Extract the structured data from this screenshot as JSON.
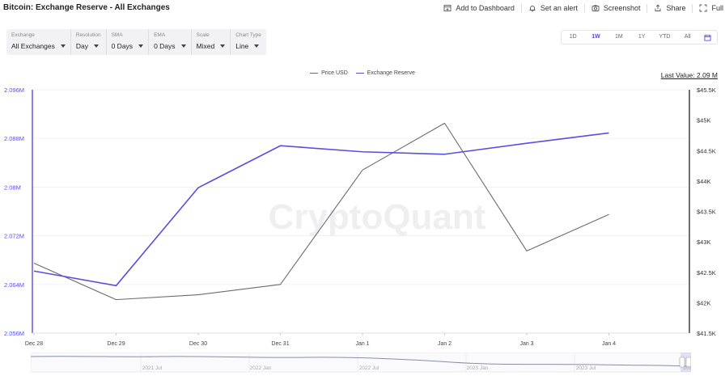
{
  "header": {
    "title": "Bitcoin: Exchange Reserve - All Exchanges",
    "actions": [
      {
        "label": "Add to Dashboard",
        "icon": "dashboard-icon"
      },
      {
        "label": "Set an alert",
        "icon": "bell-icon"
      },
      {
        "label": "Screenshot",
        "icon": "camera-icon"
      },
      {
        "label": "Share",
        "icon": "share-icon"
      },
      {
        "label": "Full",
        "icon": "fullscreen-icon"
      }
    ]
  },
  "filters": [
    {
      "label": "Exchange",
      "value": "All Exchanges"
    },
    {
      "label": "Resolution",
      "value": "Day"
    },
    {
      "label": "SMA",
      "value": "0 Days"
    },
    {
      "label": "EMA",
      "value": "0 Days"
    },
    {
      "label": "Scale",
      "value": "Mixed"
    },
    {
      "label": "Chart Type",
      "value": "Line"
    }
  ],
  "ranges": {
    "items": [
      "1D",
      "1W",
      "1M",
      "1Y",
      "YTD",
      "All"
    ],
    "active": "1W"
  },
  "last_value": "Last Value: 2.09 M",
  "colors": {
    "price": "#6b6b6b",
    "reserve": "#5a4fe0",
    "axis_left": "#5a4fe0",
    "axis_right": "#333333",
    "grid": "#ececf0",
    "navigator": "#8a8fa8"
  },
  "chart_data": {
    "type": "line",
    "watermark": "CryptoQuant",
    "categories": [
      "Dec 28",
      "Dec 29",
      "Dec 30",
      "Dec 31",
      "Jan 1",
      "Jan 2",
      "Jan 3",
      "Jan 4"
    ],
    "series": [
      {
        "name": "Price USD",
        "axis": "right",
        "values": [
          42650,
          42050,
          42130,
          42300,
          44180,
          44950,
          42850,
          43450
        ]
      },
      {
        "name": "Exchange Reserve",
        "axis": "left",
        "values": [
          2.0662,
          2.0638,
          2.0799,
          2.0868,
          2.0858,
          2.0854,
          2.0872,
          2.0889
        ]
      }
    ],
    "y_left": {
      "ticks": [
        "2.096M",
        "2.088M",
        "2.08M",
        "2.072M",
        "2.064M",
        "2.056M"
      ],
      "ylim": [
        2.056,
        2.096
      ]
    },
    "y_right": {
      "ticks": [
        "$45.5K",
        "$45K",
        "$44.5K",
        "$44K",
        "$43.5K",
        "$43K",
        "$42.5K",
        "$42K",
        "$41.5K"
      ],
      "ylim": [
        41500,
        45500
      ]
    },
    "grid": true,
    "legend_position": "top-center",
    "navigator": {
      "labels": [
        "2021 Jul",
        "2022 Jan",
        "2022 Jul",
        "2023 Jan",
        "2023 Jul",
        "2024 Jan"
      ]
    }
  }
}
